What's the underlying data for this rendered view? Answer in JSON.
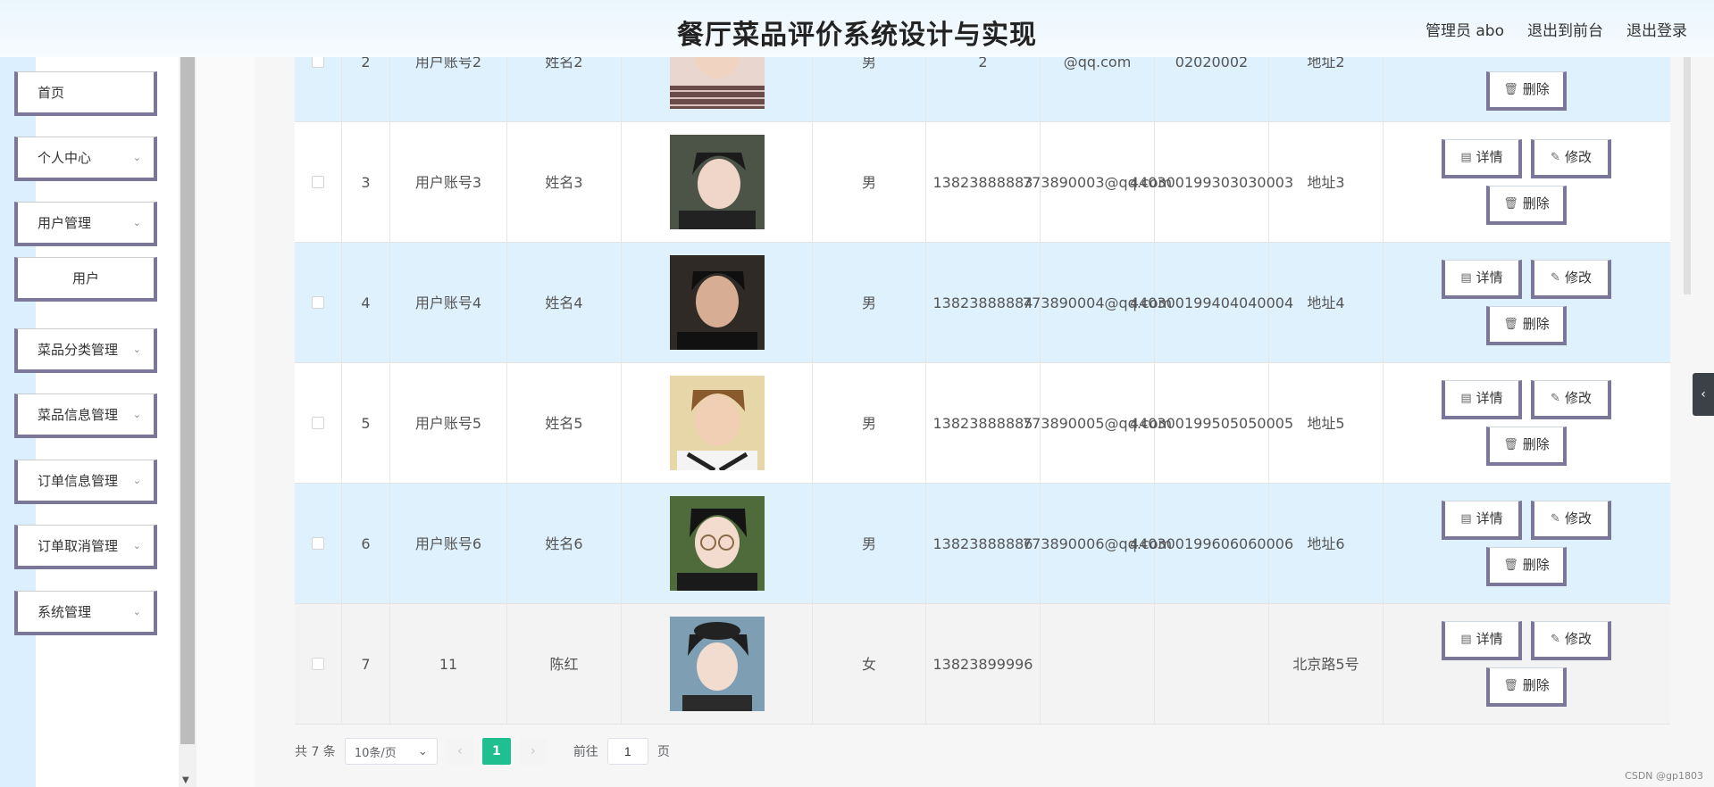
{
  "header": {
    "title": "餐厅菜品评价系统设计与实现",
    "admin": "管理员 abo",
    "to_front": "退出到前台",
    "logout": "退出登录"
  },
  "sidebar": {
    "items": [
      {
        "label": "首页"
      },
      {
        "label": "个人中心"
      },
      {
        "label": "用户管理"
      },
      {
        "label": "用户"
      },
      {
        "label": "菜品分类管理"
      },
      {
        "label": "菜品信息管理"
      },
      {
        "label": "订单信息管理"
      },
      {
        "label": "订单取消管理"
      },
      {
        "label": "系统管理"
      }
    ]
  },
  "ops": {
    "detail": "详情",
    "edit": "修改",
    "delete": "删除"
  },
  "rows": [
    {
      "idx": "2",
      "account": "用户账号2",
      "name": "姓名2",
      "sex": "男",
      "phone": "2",
      "email": "@qq.com",
      "idcard": "02020002",
      "address": "地址2"
    },
    {
      "idx": "3",
      "account": "用户账号3",
      "name": "姓名3",
      "sex": "男",
      "phone": "13823888883",
      "email": "773890003@qq.com",
      "idcard": "440300199303030003",
      "address": "地址3"
    },
    {
      "idx": "4",
      "account": "用户账号4",
      "name": "姓名4",
      "sex": "男",
      "phone": "13823888884",
      "email": "773890004@qq.com",
      "idcard": "440300199404040004",
      "address": "地址4"
    },
    {
      "idx": "5",
      "account": "用户账号5",
      "name": "姓名5",
      "sex": "男",
      "phone": "13823888885",
      "email": "773890005@qq.com",
      "idcard": "440300199505050005",
      "address": "地址5"
    },
    {
      "idx": "6",
      "account": "用户账号6",
      "name": "姓名6",
      "sex": "男",
      "phone": "13823888886",
      "email": "773890006@qq.com",
      "idcard": "440300199606060006",
      "address": "地址6"
    },
    {
      "idx": "7",
      "account": "11",
      "name": "陈红",
      "sex": "女",
      "phone": "13823899996",
      "email": "",
      "idcard": "",
      "address": "北京路5号"
    }
  ],
  "pagination": {
    "total": "共 7 条",
    "page_size": "10条/页",
    "current_page": "1",
    "goto_prefix": "前往",
    "goto_value": "1",
    "goto_suffix": "页"
  },
  "watermark": "CSDN @gp1803",
  "colors": {
    "accent": "#1fbf8f",
    "row_alt": "#dff1fd",
    "button_border": "#7a7799"
  }
}
